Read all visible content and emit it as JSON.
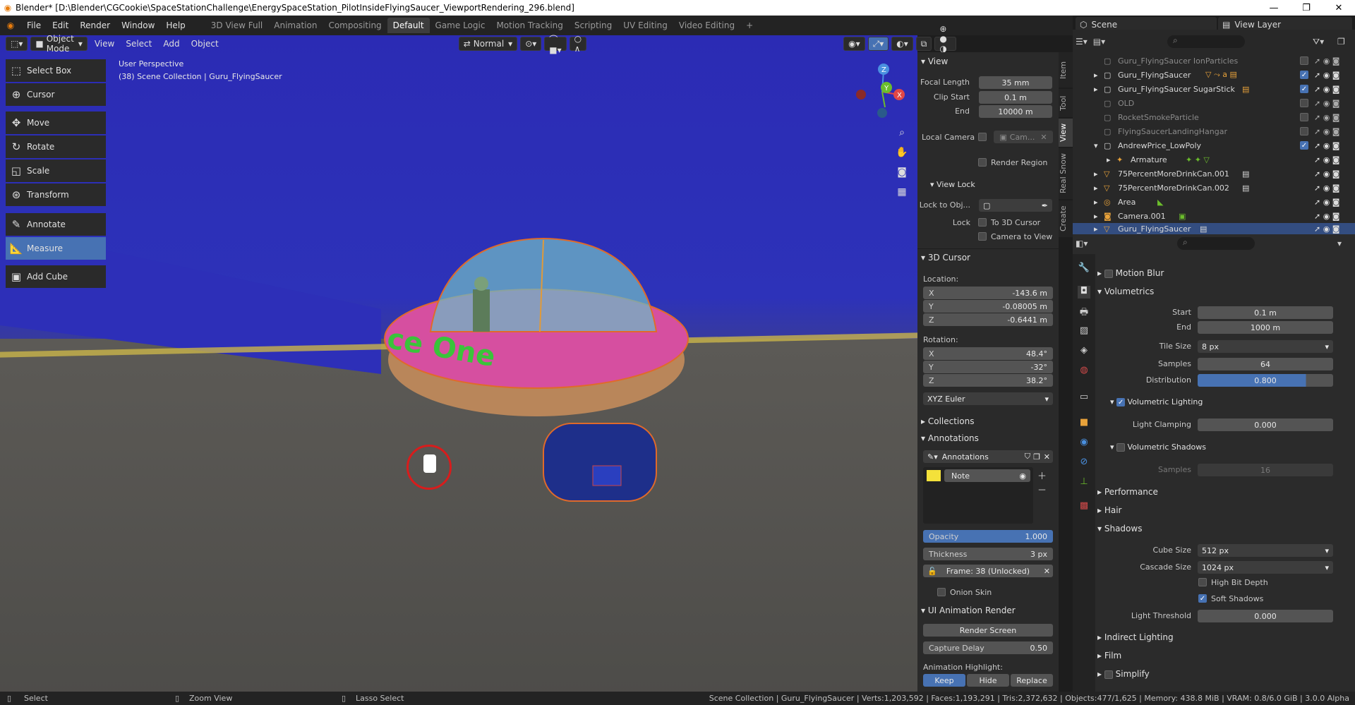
{
  "window": {
    "title": "Blender* [D:\\Blender\\CGCookie\\SpaceStationChallenge\\EnergySpaceStation_PilotInsideFlyingSaucer_ViewportRendering_296.blend]",
    "controls": [
      "—",
      "❐",
      "✕"
    ]
  },
  "menu": [
    "File",
    "Edit",
    "Render",
    "Window",
    "Help"
  ],
  "workspaces": [
    "3D View Full",
    "Animation",
    "Compositing",
    "Default",
    "Game Logic",
    "Motion Tracking",
    "Scripting",
    "UV Editing",
    "Video Editing"
  ],
  "active_workspace": "Default",
  "scene": {
    "label": "Scene",
    "view_layer": "View Layer"
  },
  "viewport": {
    "mode": "Object Mode",
    "menus": [
      "View",
      "Select",
      "Add",
      "Object"
    ],
    "orientation": "Normal",
    "overlay_title": "User Perspective",
    "overlay_subtitle": "(38) Scene Collection | Guru_FlyingSaucer",
    "saucer_text": "ce One",
    "gizmo_axes": [
      "Z",
      "Y",
      "X"
    ]
  },
  "tools": [
    {
      "label": "Select Box",
      "icon": "select-box-icon"
    },
    {
      "label": "Cursor",
      "icon": "cursor-icon"
    },
    {
      "label": "Move",
      "icon": "move-icon"
    },
    {
      "label": "Rotate",
      "icon": "rotate-icon"
    },
    {
      "label": "Scale",
      "icon": "scale-icon"
    },
    {
      "label": "Transform",
      "icon": "transform-icon"
    },
    {
      "label": "Annotate",
      "icon": "annotate-icon"
    },
    {
      "label": "Measure",
      "icon": "measure-icon",
      "active": true
    },
    {
      "label": "Add Cube",
      "icon": "add-cube-icon"
    }
  ],
  "npanel": {
    "tabs": [
      "Item",
      "Tool",
      "View",
      "Real Snow",
      "Create"
    ],
    "view": {
      "header": "View",
      "focal_length_label": "Focal Length",
      "focal_length": "35 mm",
      "clip_start_label": "Clip Start",
      "clip_start": "0.1 m",
      "end_label": "End",
      "end": "10000 m",
      "local_camera_label": "Local Camera",
      "local_camera_value": "Cam...",
      "render_region": "Render Region",
      "view_lock": "View Lock",
      "lock_to_obj": "Lock to Obj...",
      "lock_label": "Lock",
      "to_3d_cursor": "To 3D Cursor",
      "camera_to_view": "Camera to View"
    },
    "cursor": {
      "header": "3D Cursor",
      "location_label": "Location:",
      "x": "-143.6 m",
      "y": "-0.08005 m",
      "z": "-0.6441 m",
      "rotation_label": "Rotation:",
      "rx": "48.4°",
      "ry": "-32°",
      "rz": "38.2°",
      "mode": "XYZ Euler"
    },
    "collections": "Collections",
    "annotations": {
      "header": "Annotations",
      "datablock": "Annotations",
      "layer": "Note",
      "opacity_label": "Opacity",
      "opacity": "1.000",
      "thickness_label": "Thickness",
      "thickness": "3 px",
      "frame": "Frame: 38 (Unlocked)",
      "onion_skin": "Onion Skin"
    },
    "ui_anim": {
      "header": "UI Animation Render",
      "render_screen": "Render Screen",
      "capture_delay_label": "Capture Delay",
      "capture_delay": "0.50",
      "highlight_label": "Animation Highlight:",
      "keep": "Keep",
      "hide": "Hide",
      "replace": "Replace"
    }
  },
  "outliner": {
    "rows": [
      {
        "name": "Guru_FlyingSaucer IonParticles",
        "dim": true,
        "checked": false
      },
      {
        "name": "Guru_FlyingSaucer",
        "dim": false,
        "checked": true
      },
      {
        "name": "Guru_FlyingSaucer SugarStick",
        "dim": false,
        "checked": true
      },
      {
        "name": "OLD",
        "dim": true,
        "checked": false
      },
      {
        "name": "RocketSmokeParticle",
        "dim": true,
        "checked": false
      },
      {
        "name": "FlyingSaucerLandingHangar",
        "dim": true,
        "checked": false
      },
      {
        "name": "AndrewPrice_LowPoly",
        "dim": false,
        "checked": true
      },
      {
        "name": "Armature",
        "dim": false,
        "checked": null
      },
      {
        "name": "75PercentMoreDrinkCan.001",
        "dim": false,
        "checked": null
      },
      {
        "name": "75PercentMoreDrinkCan.002",
        "dim": false,
        "checked": null
      },
      {
        "name": "Area",
        "dim": false,
        "checked": null
      },
      {
        "name": "Camera.001",
        "dim": false,
        "checked": null
      },
      {
        "name": "Guru_FlyingSaucer",
        "dim": false,
        "checked": null,
        "selected": true
      }
    ]
  },
  "properties": {
    "motion_blur": "Motion Blur",
    "volumetrics": "Volumetrics",
    "start_label": "Start",
    "start": "0.1 m",
    "end_label": "End",
    "end": "1000 m",
    "tile_size_label": "Tile Size",
    "tile_size": "8 px",
    "samples_label": "Samples",
    "samples": "64",
    "distribution_label": "Distribution",
    "distribution": "0.800",
    "volumetric_lighting": "Volumetric Lighting",
    "light_clamping_label": "Light Clamping",
    "light_clamping": "0.000",
    "volumetric_shadows": "Volumetric Shadows",
    "vs_samples_label": "Samples",
    "vs_samples": "16",
    "performance": "Performance",
    "hair": "Hair",
    "shadows": "Shadows",
    "cube_size_label": "Cube Size",
    "cube_size": "512 px",
    "cascade_size_label": "Cascade Size",
    "cascade_size": "1024 px",
    "high_bit_depth": "High Bit Depth",
    "soft_shadows": "Soft Shadows",
    "light_threshold_label": "Light Threshold",
    "light_threshold": "0.000",
    "indirect_lighting": "Indirect Lighting",
    "film": "Film",
    "simplify": "Simplify"
  },
  "status": {
    "select": "Select",
    "zoom": "Zoom View",
    "lasso": "Lasso Select",
    "stats": "Scene Collection | Guru_FlyingSaucer | Verts:1,203,592 | Faces:1,193,291 | Tris:2,372,632 | Objects:477/1,625 | Memory: 438.8 MiB | VRAM: 0.8/6.0 GiB | 3.0.0 Alpha"
  },
  "colors": {
    "accent": "#4772b3",
    "active_tab": "#3d3d3d",
    "background": "#1d1d1d"
  }
}
